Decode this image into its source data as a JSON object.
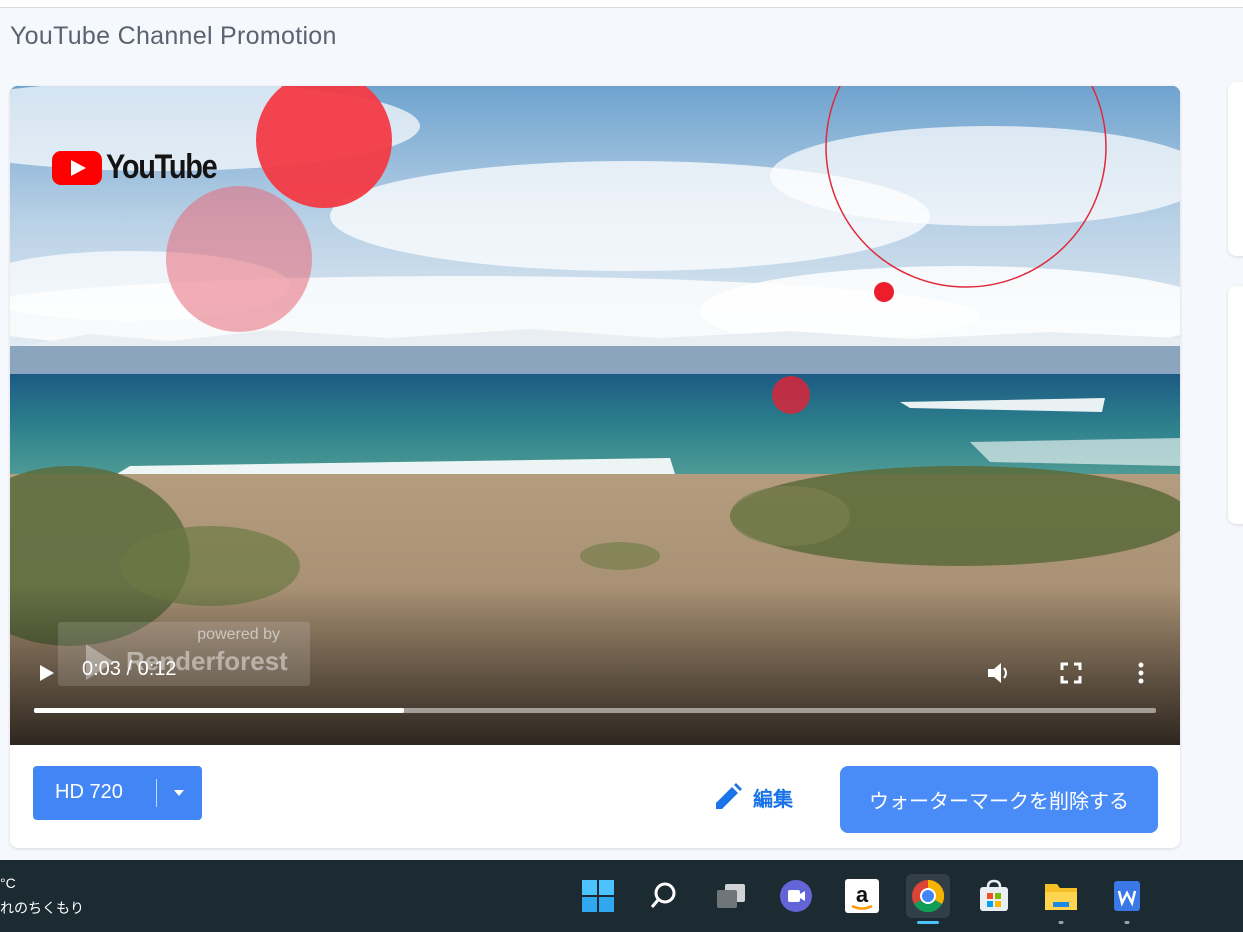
{
  "page": {
    "title": "YouTube Channel Promotion"
  },
  "video": {
    "logo_text": "YouTube",
    "watermark_small": "powered by",
    "watermark_big": "Renderforest",
    "time_display": "0:03 / 0:12",
    "progress_fraction": 0.33
  },
  "controls": {
    "quality_label": "HD 720",
    "edit_label": "編集",
    "remove_watermark_label": "ウォーターマークを削除する"
  },
  "taskbar": {
    "weather_temp": "°C",
    "weather_desc": "れのちくもり",
    "amazon_letter": "a",
    "icons": [
      "windows-start-icon",
      "search-icon",
      "task-view-icon",
      "teams-chat-icon",
      "amazon-icon",
      "chrome-icon",
      "microsoft-store-icon",
      "file-explorer-icon",
      "word-icon"
    ]
  },
  "colors": {
    "accent": "#4285f4",
    "edit": "#1a73e8",
    "taskbar": "#1c2a32",
    "youtube_red": "#ff0000"
  }
}
